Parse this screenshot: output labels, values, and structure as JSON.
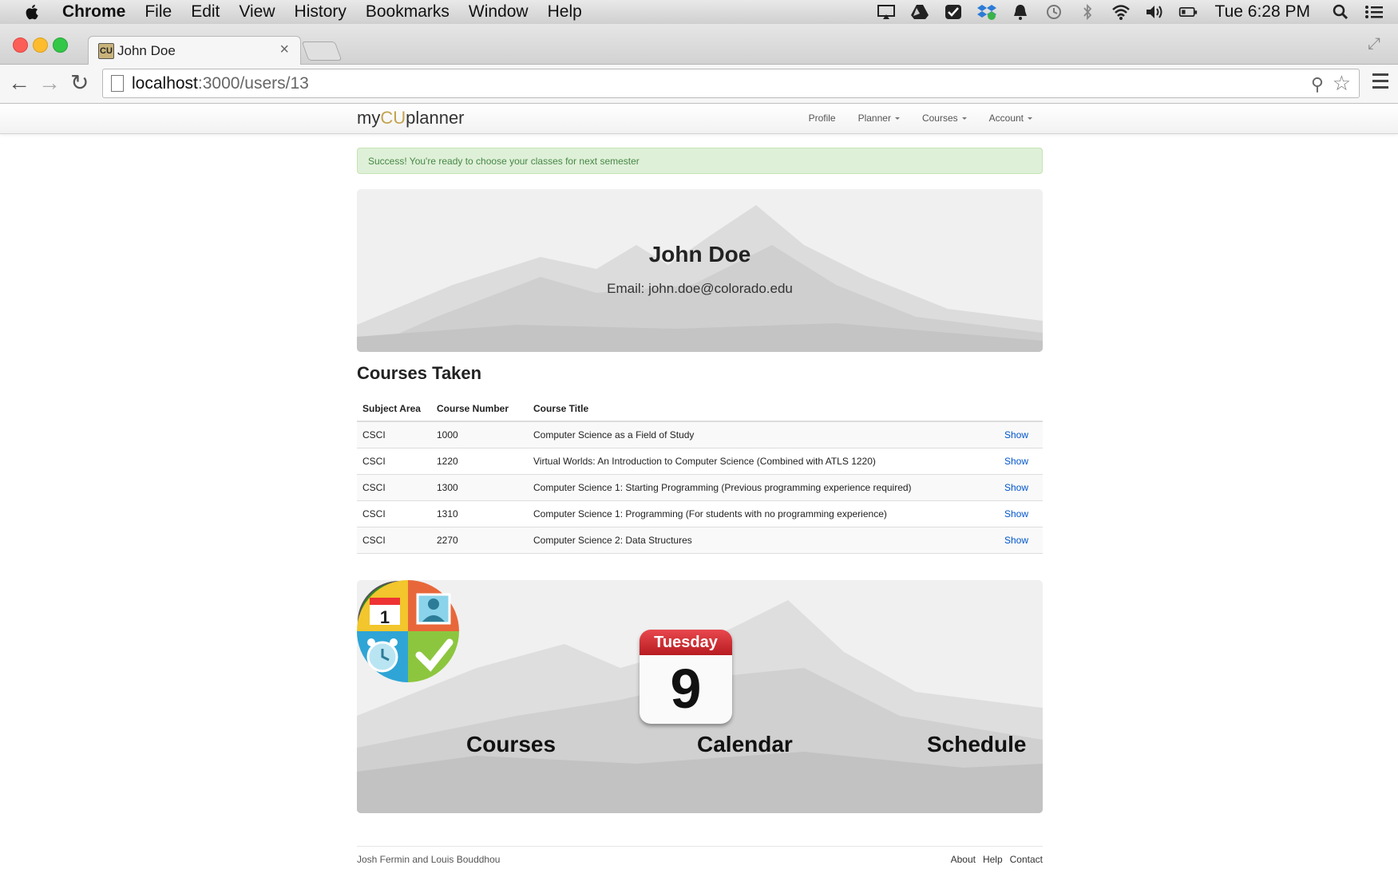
{
  "menubar": {
    "apple": "apple-icon",
    "items": [
      "Chrome",
      "File",
      "Edit",
      "View",
      "History",
      "Bookmarks",
      "Window",
      "Help"
    ],
    "clock": "Tue 6:28 PM"
  },
  "browser": {
    "tab_title": "John Doe",
    "tab_close": "×",
    "url_host": "localhost",
    "url_rest": ":3000/users/13"
  },
  "site": {
    "brand_prefix": "my",
    "brand_cu": "CU",
    "brand_suffix": "planner",
    "brand_cu_color": "#c4a34f",
    "nav": [
      "Profile",
      "Planner",
      "Courses",
      "Account"
    ]
  },
  "alert": {
    "text": "Success! You're ready to choose your classes for next semester"
  },
  "profile": {
    "name": "John Doe",
    "email": "Email: john.doe@colorado.edu"
  },
  "courses": {
    "title": "Courses Taken",
    "columns": [
      "Subject Area",
      "Course Number",
      "Course Title",
      ""
    ],
    "rows": [
      {
        "subject": "CSCI",
        "number": "1000",
        "title": "Computer Science as a Field of Study",
        "action": "Show"
      },
      {
        "subject": "CSCI",
        "number": "1220",
        "title": "Virtual Worlds: An Introduction to Computer Science (Combined with ATLS 1220)",
        "action": "Show"
      },
      {
        "subject": "CSCI",
        "number": "1300",
        "title": "Computer Science 1: Starting Programming (Previous programming experience required)",
        "action": "Show"
      },
      {
        "subject": "CSCI",
        "number": "1310",
        "title": "Computer Science 1: Programming (For students with no programming experience)",
        "action": "Show"
      },
      {
        "subject": "CSCI",
        "number": "2270",
        "title": "Computer Science 2: Data Structures",
        "action": "Show"
      }
    ]
  },
  "tiles": {
    "courses_label": "Courses",
    "calendar_label": "Calendar",
    "calendar_day": "Tuesday",
    "calendar_date": "9",
    "schedule_label": "Schedule",
    "schedule_date": "1"
  },
  "footer": {
    "credit": "Josh Fermin and Louis Bouddhou",
    "links": [
      "About",
      "Help",
      "Contact"
    ]
  }
}
